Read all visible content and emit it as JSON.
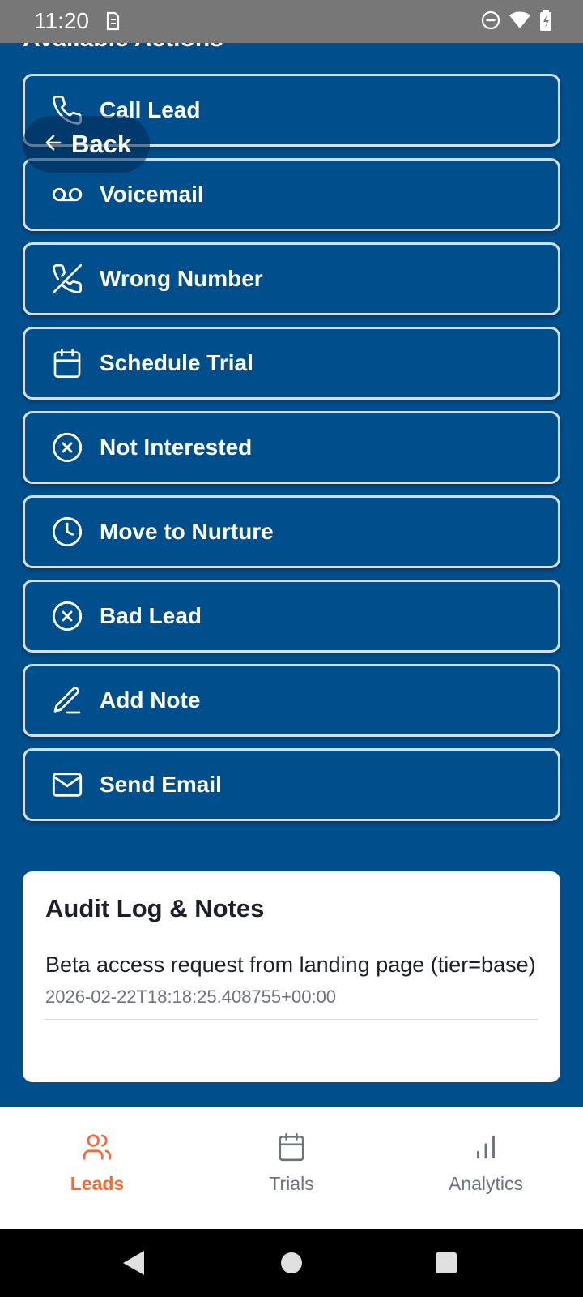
{
  "status_bar": {
    "time": "11:20"
  },
  "section_title": "Available Actions",
  "back_button": {
    "label": "Back"
  },
  "actions": [
    {
      "label": "Call Lead",
      "icon": "phone-icon"
    },
    {
      "label": "Voicemail",
      "icon": "voicemail-icon"
    },
    {
      "label": "Wrong Number",
      "icon": "phone-off-icon"
    },
    {
      "label": "Schedule Trial",
      "icon": "calendar-icon"
    },
    {
      "label": "Not Interested",
      "icon": "x-circle-icon"
    },
    {
      "label": "Move to Nurture",
      "icon": "clock-icon"
    },
    {
      "label": "Bad Lead",
      "icon": "x-circle-icon"
    },
    {
      "label": "Add Note",
      "icon": "pencil-icon"
    },
    {
      "label": "Send Email",
      "icon": "mail-icon"
    }
  ],
  "audit": {
    "title": "Audit Log & Notes",
    "entries": [
      {
        "note": "Beta access request from landing page (tier=base)",
        "timestamp": "2026-02-22T18:18:25.408755+00:00"
      }
    ]
  },
  "bottom_nav": {
    "items": [
      {
        "label": "Leads",
        "icon": "users-icon",
        "active": true
      },
      {
        "label": "Trials",
        "icon": "calendar-icon",
        "active": false
      },
      {
        "label": "Analytics",
        "icon": "bar-chart-icon",
        "active": false
      }
    ]
  },
  "colors": {
    "background": "#004E8C",
    "accent": "#F26A35",
    "nav_inactive": "#6B7280"
  }
}
